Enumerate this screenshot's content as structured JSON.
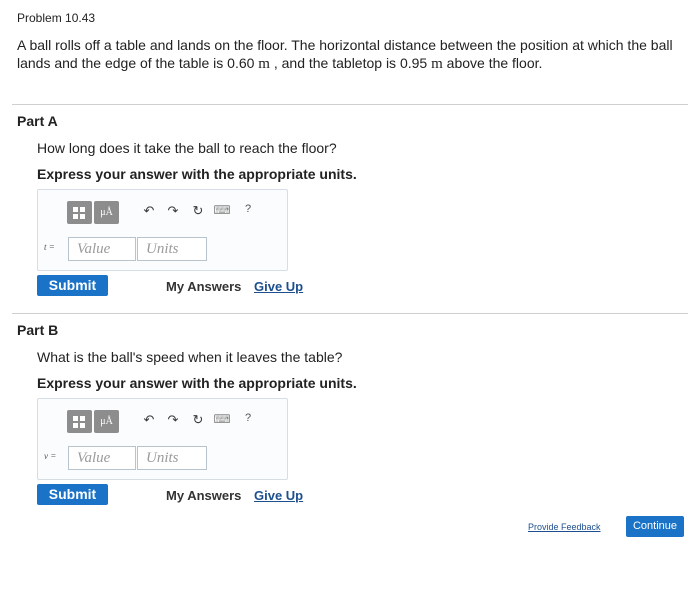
{
  "problem": {
    "title": "Problem 10.43",
    "text_1": "A ball rolls off a table and lands on the floor. The horizontal distance between the position at which the ball lands and the edge of the table is 0.60 ",
    "unit_1": "m",
    "text_2": " , and the tabletop is 0.95 ",
    "unit_2": "m",
    "text_3": " above the floor."
  },
  "part_a": {
    "title": "Part A",
    "question": "How long does it take the ball to reach the floor?",
    "instruction": "Express your answer with the appropriate units.",
    "var_label": "t =",
    "value_placeholder": "Value",
    "units_placeholder": "Units",
    "submit_label": "Submit",
    "my_answers_label": "My Answers",
    "give_up_label": "Give Up"
  },
  "part_b": {
    "title": "Part B",
    "question": "What is the ball's speed when it leaves the table?",
    "instruction": "Express your answer with the appropriate units.",
    "var_label": "v =",
    "value_placeholder": "Value",
    "units_placeholder": "Units",
    "submit_label": "Submit",
    "my_answers_label": "My Answers",
    "give_up_label": "Give Up"
  },
  "toolbar": {
    "mu_label": "μÅ",
    "undo_icon": "↶",
    "redo_icon": "↷",
    "reset_icon": "↻",
    "keyboard_icon": "⌨",
    "help_icon": "?"
  },
  "footer": {
    "feedback_label": "Provide Feedback",
    "continue_label": "Continue"
  },
  "colors": {
    "accent": "#1a73c6",
    "link": "#1d4f8e",
    "toolbar_button": "#8d8d8d"
  }
}
